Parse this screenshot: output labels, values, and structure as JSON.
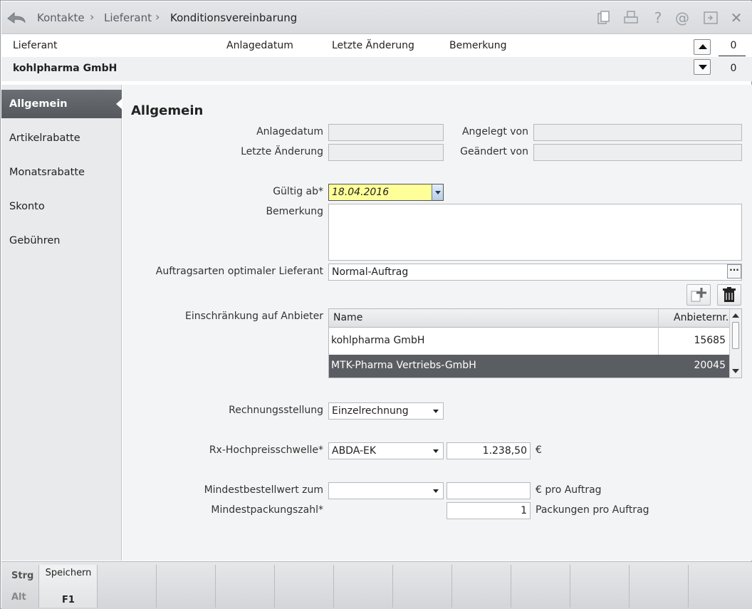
{
  "breadcrumb": [
    "Kontakte",
    "Lieferant",
    "Konditionsvereinbarung"
  ],
  "toolbar_icons": [
    "copy-icon",
    "print-icon",
    "help-icon",
    "email-icon",
    "window-icon",
    "close-icon"
  ],
  "toolbar_glyphs": {
    "help": "?",
    "email": "@",
    "close": "✕"
  },
  "header": {
    "columns": [
      "Lieferant",
      "Anlagedatum",
      "Letzte Änderung",
      "Bemerkung"
    ],
    "supplier": "kohlpharma GmbH",
    "counter_top": "0",
    "counter_bottom": "0"
  },
  "sidebar": {
    "items": [
      {
        "label": "Allgemein",
        "active": true
      },
      {
        "label": "Artikelrabatte"
      },
      {
        "label": "Monatsrabatte"
      },
      {
        "label": "Skonto"
      },
      {
        "label": "Gebühren"
      }
    ]
  },
  "form": {
    "title": "Allgemein",
    "anlagedatum": {
      "label": "Anlagedatum",
      "value": ""
    },
    "angelegt_von": {
      "label": "Angelegt von",
      "value": ""
    },
    "letzte_aenderung": {
      "label": "Letzte Änderung",
      "value": ""
    },
    "geaendert_von": {
      "label": "Geändert von",
      "value": ""
    },
    "gueltig_ab": {
      "label": "Gültig ab*",
      "value": "18.04.2016"
    },
    "bemerkung": {
      "label": "Bemerkung",
      "value": ""
    },
    "auftragsarten": {
      "label": "Auftragsarten optimaler Lieferant",
      "value": "Normal-Auftrag",
      "button": "···"
    },
    "einschraenkung": {
      "label": "Einschränkung auf Anbieter",
      "columns": [
        "Name",
        "Anbieternr."
      ],
      "rows": [
        {
          "name": "kohlpharma GmbH",
          "nr": "15685",
          "selected": false
        },
        {
          "name": "MTK-Pharma Vertriebs-GmbH",
          "nr": "20045",
          "selected": true
        }
      ]
    },
    "rechnungsstellung": {
      "label": "Rechnungsstellung",
      "value": "Einzelrechnung"
    },
    "rx_hochpreis": {
      "label": "Rx-Hochpreisschwelle*",
      "value": "ABDA-EK",
      "amount": "1.238,50",
      "unit": "€"
    },
    "mindestbestellwert": {
      "label": "Mindestbestellwert zum",
      "value": "",
      "amount": "",
      "unit": "€ pro Auftrag"
    },
    "mindestpackungszahl": {
      "label": "Mindestpackungszahl*",
      "amount": "1",
      "unit": "Packungen pro Auftrag"
    }
  },
  "fkeys": {
    "mod_top": "Strg",
    "mod_bottom": "Alt",
    "keys": [
      {
        "label": "Speichern",
        "key": "F1"
      }
    ]
  },
  "colors": {
    "accent_field": "#ffff99",
    "selection": "#5a5d61"
  }
}
